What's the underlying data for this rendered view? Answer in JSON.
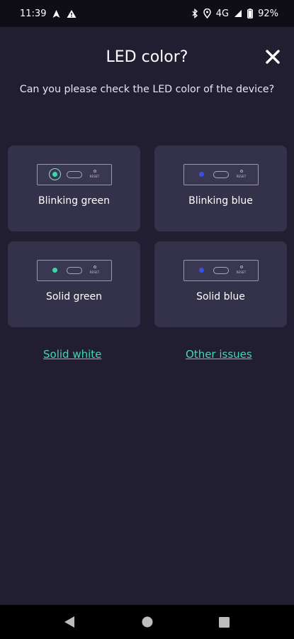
{
  "status_bar": {
    "time": "11:39",
    "network": "4G",
    "battery": "92%",
    "left_icons": [
      "navigation-icon",
      "alert-icon"
    ],
    "right_icons": [
      "bluetooth-icon",
      "location-icon",
      "signal-icon",
      "battery-icon"
    ]
  },
  "header": {
    "title": "LED color?",
    "close_icon": "close-icon"
  },
  "subtitle": "Can you please check the LED color of the device?",
  "device_reset_label": "RESET",
  "options": [
    {
      "label": "Blinking green",
      "led_color": "#37d9a8",
      "blinking": true
    },
    {
      "label": "Blinking blue",
      "led_color": "#3b4fe0",
      "blinking": true
    },
    {
      "label": "Solid green",
      "led_color": "#37d9a8",
      "blinking": false
    },
    {
      "label": "Solid blue",
      "led_color": "#3b4fe0",
      "blinking": false
    }
  ],
  "links": {
    "solid_white": "Solid white",
    "other_issues": "Other issues"
  },
  "colors": {
    "background": "#201e30",
    "card": "#34314a",
    "accent": "#3ddbb3"
  },
  "nav_bar": [
    "back-icon",
    "home-icon",
    "recents-icon"
  ]
}
